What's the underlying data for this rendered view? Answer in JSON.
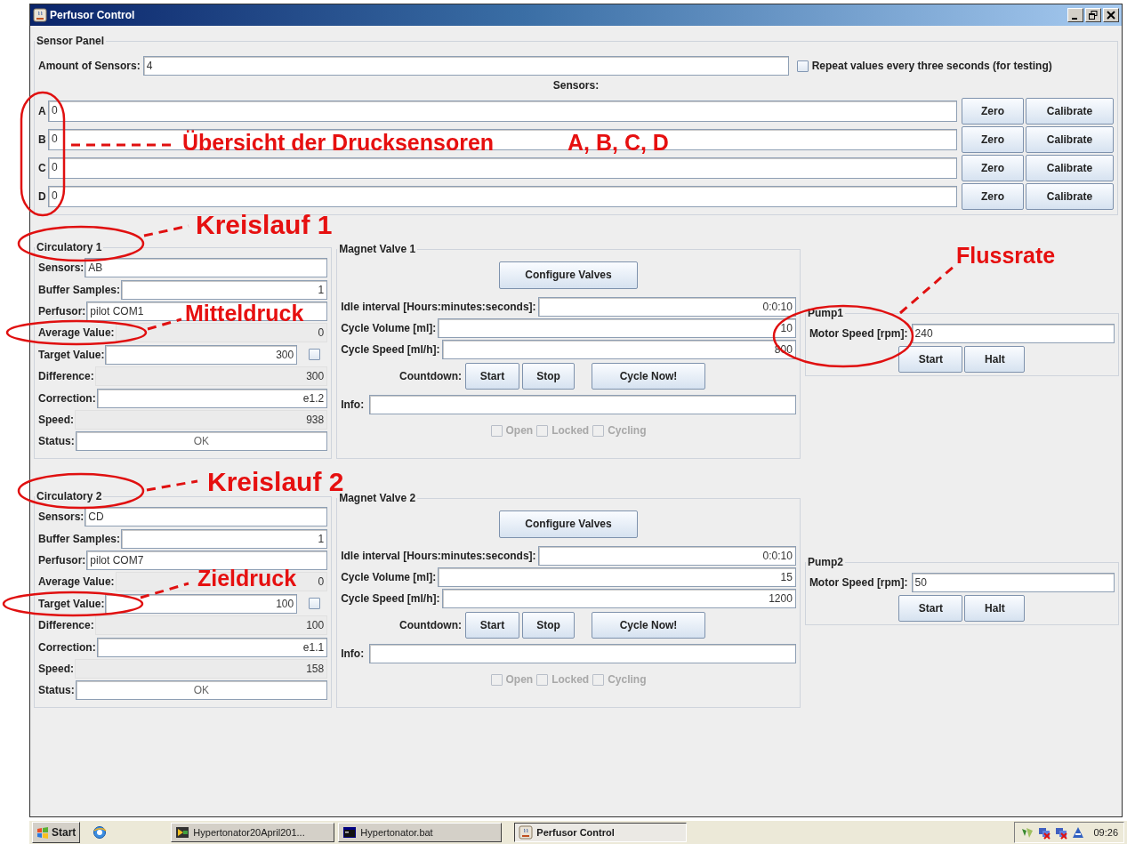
{
  "window": {
    "title": "Perfusor Control"
  },
  "sensor_panel": {
    "title": "Sensor Panel",
    "amount_label": "Amount of Sensors:",
    "amount_value": "4",
    "repeat_checkbox": {
      "label": "Repeat values every three seconds (for testing)",
      "checked": false
    },
    "sensors_heading": "Sensors:",
    "sensors": [
      {
        "letter": "A",
        "value": "0",
        "zero_button": "Zero",
        "calibrate_button": "Calibrate"
      },
      {
        "letter": "B",
        "value": "0",
        "zero_button": "Zero",
        "calibrate_button": "Calibrate"
      },
      {
        "letter": "C",
        "value": "0",
        "zero_button": "Zero",
        "calibrate_button": "Calibrate"
      },
      {
        "letter": "D",
        "value": "0",
        "zero_button": "Zero",
        "calibrate_button": "Calibrate"
      }
    ]
  },
  "circuits": [
    {
      "circulatory": {
        "title": "Circulatory 1",
        "fields": [
          {
            "label": "Sensors:",
            "value": "AB",
            "kind": "text"
          },
          {
            "label": "Buffer Samples:",
            "value": "1",
            "kind": "number"
          },
          {
            "label": "Perfusor:",
            "value": "pilot COM1",
            "kind": "text"
          },
          {
            "label": "Average Value:",
            "value": "0",
            "kind": "display"
          },
          {
            "label": "Target Value:",
            "value": "300",
            "kind": "target",
            "checked": false
          },
          {
            "label": "Difference:",
            "value": "300",
            "kind": "display"
          },
          {
            "label": "Correction:",
            "value": "e1.2",
            "kind": "number"
          },
          {
            "label": "Speed:",
            "value": "938",
            "kind": "display"
          },
          {
            "label": "Status:",
            "value": "OK",
            "kind": "status"
          }
        ]
      },
      "magnet_valve": {
        "title": "Magnet Valve 1",
        "configure_button": "Configure Valves",
        "fields": [
          {
            "label": "Idle interval [Hours:minutes:seconds]:",
            "value": "0:0:10"
          },
          {
            "label": "Cycle Volume [ml]:",
            "value": "10"
          },
          {
            "label": "Cycle Speed [ml/h]:",
            "value": "800"
          }
        ],
        "countdown_label": "Countdown:",
        "buttons": [
          "Start",
          "Stop",
          "Cycle Now!"
        ],
        "info_label": "Info:",
        "checkboxes": [
          {
            "label": "Open",
            "checked": false,
            "disabled": true
          },
          {
            "label": "Locked",
            "checked": false,
            "disabled": true
          },
          {
            "label": "Cycling",
            "checked": false,
            "disabled": true
          }
        ]
      },
      "pump": {
        "title": "Pump1",
        "label": "Motor Speed [rpm]:",
        "value": "240",
        "buttons": [
          "Start",
          "Halt"
        ]
      }
    },
    {
      "circulatory": {
        "title": "Circulatory 2",
        "fields": [
          {
            "label": "Sensors:",
            "value": "CD",
            "kind": "text"
          },
          {
            "label": "Buffer Samples:",
            "value": "1",
            "kind": "number"
          },
          {
            "label": "Perfusor:",
            "value": "pilot COM7",
            "kind": "text"
          },
          {
            "label": "Average Value:",
            "value": "0",
            "kind": "display"
          },
          {
            "label": "Target Value:",
            "value": "100",
            "kind": "target",
            "checked": false
          },
          {
            "label": "Difference:",
            "value": "100",
            "kind": "display"
          },
          {
            "label": "Correction:",
            "value": "e1.1",
            "kind": "number"
          },
          {
            "label": "Speed:",
            "value": "158",
            "kind": "display"
          },
          {
            "label": "Status:",
            "value": "OK",
            "kind": "status"
          }
        ]
      },
      "magnet_valve": {
        "title": "Magnet Valve 2",
        "configure_button": "Configure Valves",
        "fields": [
          {
            "label": "Idle interval [Hours:minutes:seconds]:",
            "value": "0:0:10"
          },
          {
            "label": "Cycle Volume [ml]:",
            "value": "15"
          },
          {
            "label": "Cycle Speed [ml/h]:",
            "value": "1200"
          }
        ],
        "countdown_label": "Countdown:",
        "buttons": [
          "Start",
          "Stop",
          "Cycle Now!"
        ],
        "info_label": "Info:",
        "checkboxes": [
          {
            "label": "Open",
            "checked": false,
            "disabled": true
          },
          {
            "label": "Locked",
            "checked": false,
            "disabled": true
          },
          {
            "label": "Cycling",
            "checked": false,
            "disabled": true
          }
        ]
      },
      "pump": {
        "title": "Pump2",
        "label": "Motor Speed [rpm]:",
        "value": "50",
        "buttons": [
          "Start",
          "Halt"
        ]
      }
    }
  ],
  "annotations": [
    {
      "text": "Übersicht der Drucksensoren"
    },
    {
      "text": "A, B, C, D"
    },
    {
      "text": "Kreislauf 1"
    },
    {
      "text": "Mitteldruck"
    },
    {
      "text": "Kreislauf 2"
    },
    {
      "text": "Zieldruck"
    },
    {
      "text": "Flussrate"
    }
  ],
  "taskbar": {
    "start": "Start",
    "tasks": [
      {
        "label": "Hypertonator20April201...",
        "selected": false
      },
      {
        "label": "Hypertonator.bat",
        "selected": false
      },
      {
        "label": "Perfusor Control",
        "selected": true
      }
    ],
    "clock": "09:26"
  }
}
